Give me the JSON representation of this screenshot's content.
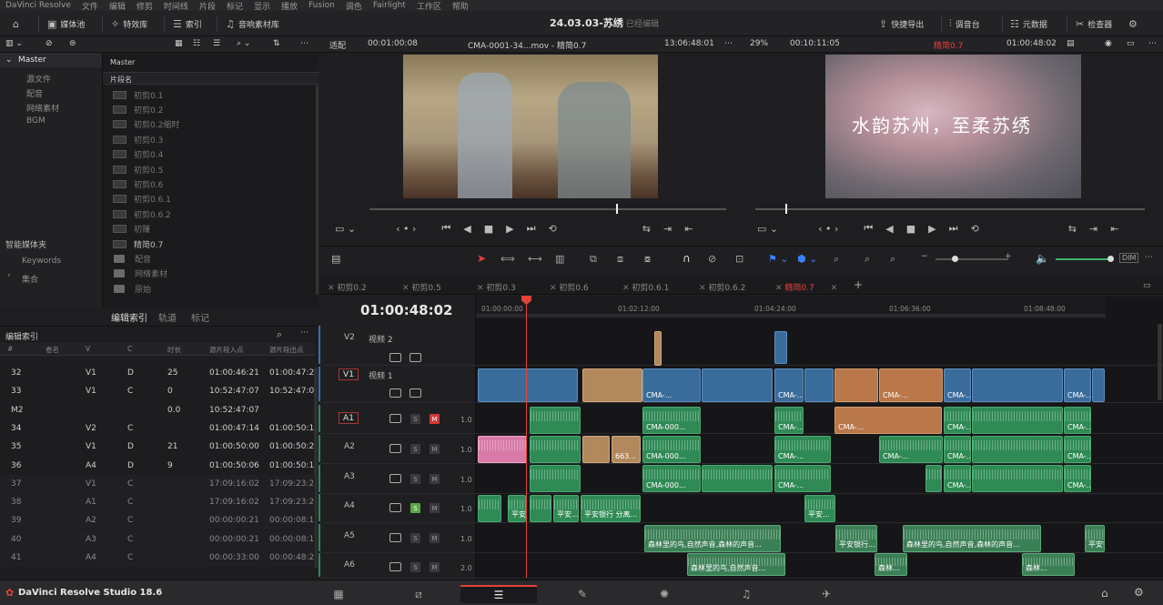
{
  "menu": [
    "DaVinci Resolve",
    "文件",
    "编辑",
    "修剪",
    "时间线",
    "片段",
    "标记",
    "显示",
    "播放",
    "Fusion",
    "调色",
    "Fairlight",
    "工作区",
    "帮助"
  ],
  "toolbar": {
    "media_pool": "媒体池",
    "effects": "特效库",
    "index": "索引",
    "sound_library": "音响素材库",
    "quick_export": "快捷导出",
    "mixer": "调音台",
    "metadata": "元数据",
    "inspector": "检查器"
  },
  "project": {
    "title": "24.03.03-苏绣",
    "status": "已经编辑"
  },
  "source_viewer": {
    "fit": "适配",
    "timecode_left": "00:01:00:08",
    "clip_name": "CMA-0001-34...mov - 精简0.7",
    "timecode_right": "13:06:48:01"
  },
  "record_viewer": {
    "zoom": "29%",
    "duration": "00:10:11:05",
    "timeline_name": "精简0.7",
    "timecode": "01:00:48:02",
    "overlay_text": "水韵苏州，至柔苏绣"
  },
  "bins": {
    "master": "Master",
    "items": [
      "源文件",
      "配音",
      "网络素材",
      "BGM"
    ],
    "smart_bins": "智能媒体夹",
    "smart_items": [
      "Keywords",
      "集合"
    ]
  },
  "clip_list": {
    "header": "Master",
    "column": "片段名",
    "items": [
      {
        "name": "初剪0.1",
        "kind": "timeline"
      },
      {
        "name": "初剪0.2",
        "kind": "timeline"
      },
      {
        "name": "初剪0.2缩时",
        "kind": "timeline"
      },
      {
        "name": "初剪0.3",
        "kind": "timeline"
      },
      {
        "name": "初剪0.4",
        "kind": "timeline"
      },
      {
        "name": "初剪0.5",
        "kind": "timeline"
      },
      {
        "name": "初剪0.6",
        "kind": "timeline"
      },
      {
        "name": "初剪0.6.1",
        "kind": "timeline"
      },
      {
        "name": "初剪0.6.2",
        "kind": "timeline"
      },
      {
        "name": "初赚",
        "kind": "timeline"
      },
      {
        "name": "精简0.7",
        "kind": "timeline"
      },
      {
        "name": "配音",
        "kind": "folder"
      },
      {
        "name": "网络素材",
        "kind": "folder"
      },
      {
        "name": "原始",
        "kind": "folder"
      }
    ]
  },
  "edl_tabs": [
    "编辑索引",
    "轨道",
    "标记"
  ],
  "edl": {
    "title": "编辑索引",
    "columns": [
      "#",
      "卷名",
      "V",
      "C",
      "时长",
      "源片段入点",
      "源片段出点"
    ],
    "rows": [
      {
        "n": "32",
        "v": "V1",
        "c": "D",
        "dur": "25",
        "in": "01:00:46:21",
        "out": "01:00:47:2",
        "dim": false
      },
      {
        "n": "33",
        "v": "V1",
        "c": "C",
        "dur": "0",
        "in": "10:52:47:07",
        "out": "10:52:47:0",
        "dim": false
      },
      {
        "n": "M2",
        "v": "",
        "c": "",
        "dur": "0.0",
        "in": "10:52:47:07",
        "out": "",
        "dim": false
      },
      {
        "n": "34",
        "v": "V2",
        "c": "C",
        "dur": "",
        "in": "01:00:47:14",
        "out": "01:00:50:1",
        "dim": false
      },
      {
        "n": "35",
        "v": "V1",
        "c": "D",
        "dur": "21",
        "in": "01:00:50:00",
        "out": "01:00:50:2",
        "dim": false
      },
      {
        "n": "36",
        "v": "A4",
        "c": "D",
        "dur": "9",
        "in": "01:00:50:06",
        "out": "01:00:50:1",
        "dim": false
      },
      {
        "n": "37",
        "v": "V1",
        "c": "C",
        "dur": "",
        "in": "17:09:16:02",
        "out": "17:09:23:2",
        "dim": true
      },
      {
        "n": "38",
        "v": "A1",
        "c": "C",
        "dur": "",
        "in": "17:09:16:02",
        "out": "17:09:23:2",
        "dim": true
      },
      {
        "n": "39",
        "v": "A2",
        "c": "C",
        "dur": "",
        "in": "00:00:00:21",
        "out": "00:00:08:1",
        "dim": true
      },
      {
        "n": "40",
        "v": "A3",
        "c": "C",
        "dur": "",
        "in": "00:00:00:21",
        "out": "00:00:08:1",
        "dim": true
      },
      {
        "n": "41",
        "v": "A4",
        "c": "C",
        "dur": "",
        "in": "00:00:33:00",
        "out": "00:00:48:2",
        "dim": true
      }
    ]
  },
  "timeline_tabs": [
    "初剪0.2",
    "初剪0.5",
    "初剪0.3",
    "初剪0.6",
    "初剪0.6.1",
    "初剪0.6.2",
    "精简0.7"
  ],
  "timeline": {
    "timecode": "01:00:48:02",
    "ruler": [
      "01:00:00:00",
      "01:02:12:00",
      "01:04:24:00",
      "01:06:36:00",
      "01:08:48:00"
    ],
    "tracks": [
      {
        "id": "V2",
        "name": "视频 2"
      },
      {
        "id": "V1",
        "name": "视频 1"
      },
      {
        "id": "A1",
        "vol": "1.0"
      },
      {
        "id": "A2",
        "vol": "1.0"
      },
      {
        "id": "A3",
        "vol": "1.0"
      },
      {
        "id": "A4",
        "vol": "1.0"
      },
      {
        "id": "A5",
        "vol": "1.0"
      },
      {
        "id": "A6",
        "vol": "2.0"
      }
    ],
    "clip_labels": {
      "cma": "CMA-...",
      "cma000": "CMA-000...",
      "clip663": "663...",
      "ping_an": "平安...",
      "ping_an_bank": "平安银行 分离...",
      "forest": "森林里的鸟,自然声音,森林的声音...",
      "forest_short": "森林里的鸟,自然声音...",
      "ping_an_bank2": "平安银行...",
      "forest_tiny": "森林..."
    }
  },
  "bottom": {
    "brand": "DaVinci Resolve Studio 18.6"
  },
  "colors": {
    "accent": "#e2423a",
    "video_clip": "#3a6c9b",
    "audio_clip": "#2f8a55",
    "orange_clip": "#b9774a"
  }
}
